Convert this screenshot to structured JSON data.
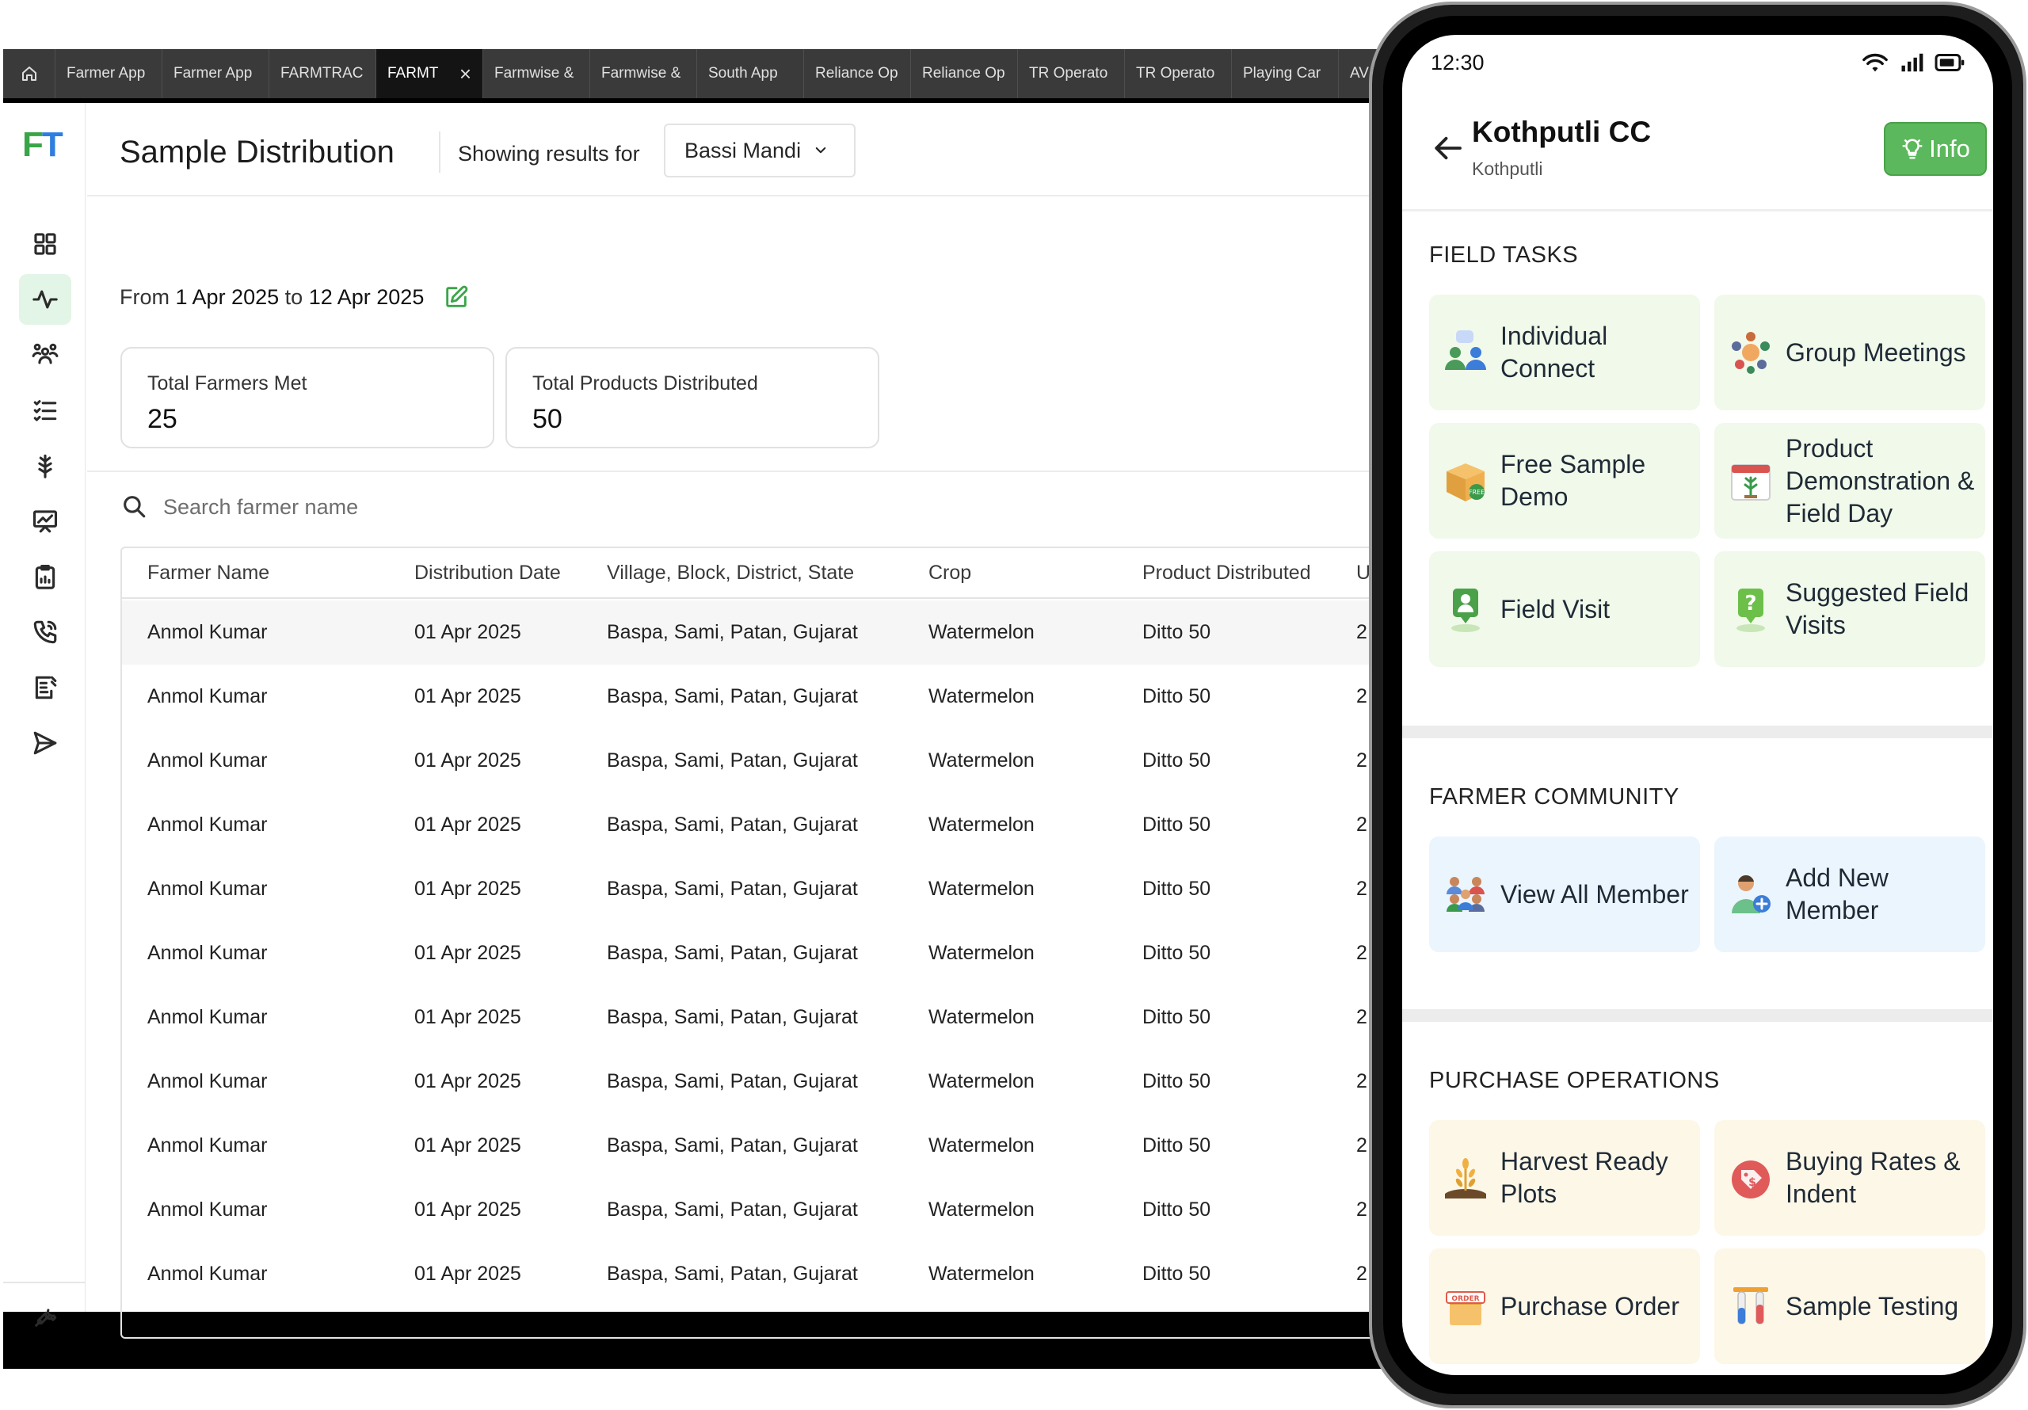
{
  "browser": {
    "tabs": [
      {
        "label": "Farmer App"
      },
      {
        "label": "Farmer App"
      },
      {
        "label": "FARMTRAC"
      },
      {
        "label": "FARMT",
        "active": true
      },
      {
        "label": "Farmwise &"
      },
      {
        "label": "Farmwise &"
      },
      {
        "label": "South App"
      },
      {
        "label": "Reliance Op"
      },
      {
        "label": "Reliance Op"
      },
      {
        "label": "TR Operato"
      },
      {
        "label": "TR Operato"
      },
      {
        "label": "Playing Car"
      },
      {
        "label": "AV"
      }
    ]
  },
  "sidebar": {
    "logo": {
      "f": "F",
      "t": "T"
    },
    "items": [
      {
        "icon": "dashboard-icon"
      },
      {
        "icon": "activity-icon",
        "active": true
      },
      {
        "icon": "community-icon"
      },
      {
        "icon": "checklist-icon"
      },
      {
        "icon": "crop-icon"
      },
      {
        "icon": "presentation-icon"
      },
      {
        "icon": "clipboard-icon"
      },
      {
        "icon": "phone-call-icon"
      },
      {
        "icon": "report-icon"
      },
      {
        "icon": "send-icon"
      }
    ],
    "footer_icon": "wrench-icon"
  },
  "header": {
    "title": "Sample Distribution",
    "showing_label": "Showing results for",
    "mandi": "Bassi Mandi"
  },
  "date_range": {
    "from_label": "From",
    "from": "1 Apr 2025",
    "to_label": "to",
    "to": "12 Apr 2025"
  },
  "stats": [
    {
      "label": "Total Farmers Met",
      "value": "25"
    },
    {
      "label": "Total Products Distributed",
      "value": "50"
    }
  ],
  "search": {
    "placeholder": "Search farmer name",
    "value": ""
  },
  "table": {
    "columns": [
      "Farmer Name",
      "Distribution Date",
      "Village, Block, District, State",
      "Crop",
      "Product Distributed",
      "U"
    ],
    "rows": [
      [
        "Anmol Kumar",
        "01 Apr 2025",
        "Baspa, Sami, Patan, Gujarat",
        "Watermelon",
        "Ditto 50",
        "2"
      ],
      [
        "Anmol Kumar",
        "01 Apr 2025",
        "Baspa, Sami, Patan, Gujarat",
        "Watermelon",
        "Ditto 50",
        "2"
      ],
      [
        "Anmol Kumar",
        "01 Apr 2025",
        "Baspa, Sami, Patan, Gujarat",
        "Watermelon",
        "Ditto 50",
        "2"
      ],
      [
        "Anmol Kumar",
        "01 Apr 2025",
        "Baspa, Sami, Patan, Gujarat",
        "Watermelon",
        "Ditto 50",
        "2"
      ],
      [
        "Anmol Kumar",
        "01 Apr 2025",
        "Baspa, Sami, Patan, Gujarat",
        "Watermelon",
        "Ditto 50",
        "2"
      ],
      [
        "Anmol Kumar",
        "01 Apr 2025",
        "Baspa, Sami, Patan, Gujarat",
        "Watermelon",
        "Ditto 50",
        "2"
      ],
      [
        "Anmol Kumar",
        "01 Apr 2025",
        "Baspa, Sami, Patan, Gujarat",
        "Watermelon",
        "Ditto 50",
        "2"
      ],
      [
        "Anmol Kumar",
        "01 Apr 2025",
        "Baspa, Sami, Patan, Gujarat",
        "Watermelon",
        "Ditto 50",
        "2"
      ],
      [
        "Anmol Kumar",
        "01 Apr 2025",
        "Baspa, Sami, Patan, Gujarat",
        "Watermelon",
        "Ditto 50",
        "2"
      ],
      [
        "Anmol Kumar",
        "01 Apr 2025",
        "Baspa, Sami, Patan, Gujarat",
        "Watermelon",
        "Ditto 50",
        "2"
      ],
      [
        "Anmol Kumar",
        "01 Apr 2025",
        "Baspa, Sami, Patan, Gujarat",
        "Watermelon",
        "Ditto 50",
        "2"
      ]
    ]
  },
  "phone": {
    "status_time": "12:30",
    "title": "Kothputli CC",
    "subtitle": "Kothputli",
    "info_label": "Info",
    "sections": [
      {
        "title": "FIELD TASKS",
        "theme": "green",
        "cards": [
          {
            "label": "Individual Connect",
            "icon": "individual-connect-icon"
          },
          {
            "label": "Group Meetings",
            "icon": "group-meetings-icon"
          },
          {
            "label": "Free Sample Demo",
            "icon": "free-sample-box-icon"
          },
          {
            "label": "Product Demonstration & Field Day",
            "icon": "calendar-plant-icon"
          },
          {
            "label": "Field Visit",
            "icon": "field-visit-pin-icon"
          },
          {
            "label": "Suggested Field Visits",
            "icon": "suggested-visit-icon"
          }
        ]
      },
      {
        "title": "FARMER COMMUNITY",
        "theme": "blue",
        "cards": [
          {
            "label": "View All Member",
            "icon": "members-group-icon"
          },
          {
            "label": "Add New Member",
            "icon": "add-member-icon"
          }
        ]
      },
      {
        "title": "PURCHASE OPERATIONS",
        "theme": "cream",
        "cards": [
          {
            "label": "Harvest Ready Plots",
            "icon": "harvest-plant-icon"
          },
          {
            "label": "Buying Rates & Indent",
            "icon": "price-tag-icon"
          },
          {
            "label": "Purchase Order",
            "icon": "order-box-icon"
          },
          {
            "label": "Sample Testing",
            "icon": "test-tubes-icon"
          }
        ]
      }
    ]
  },
  "colors": {
    "accent_green": "#5cb85c",
    "logo_green": "#3aa548",
    "logo_blue": "#2f7de0",
    "card_green": "#f1f9ea",
    "card_blue": "#ebf5fd",
    "card_cream": "#fdf7e8"
  }
}
